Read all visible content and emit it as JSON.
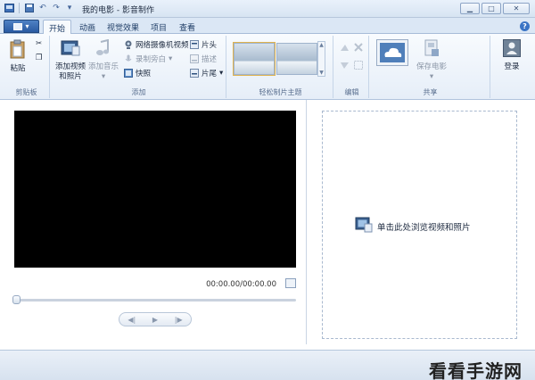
{
  "window": {
    "title": "我的电影 - 影音制作",
    "minimize_icon": "▁",
    "maximize_icon": "□",
    "close_icon": "✕"
  },
  "quick_access": {
    "save_icon": "💾",
    "undo_icon": "↶",
    "redo_icon": "↷",
    "more_icon": "▾"
  },
  "app_menu": {
    "arrow": "▾"
  },
  "tabs": [
    "开始",
    "动画",
    "视觉效果",
    "项目",
    "查看"
  ],
  "help": "?",
  "ribbon": {
    "clipboard": {
      "group_label": "剪贴板",
      "paste": "粘贴",
      "cut_icon": "✂",
      "copy_icon": "❐"
    },
    "add": {
      "group_label": "添加",
      "add_videos_line1": "添加视频",
      "add_videos_line2": "和照片",
      "add_music": "添加音乐",
      "add_music_arrow": "▾",
      "webcam": "网络摄像机视频",
      "narration": "录制旁白",
      "narration_arrow": "▾",
      "snapshot": "快照",
      "title": "片头",
      "caption": "描述",
      "credits": "片尾",
      "credits_arrow": "▾"
    },
    "themes": {
      "group_label": "轻松制片主题"
    },
    "editing": {
      "group_label": "编辑"
    },
    "share": {
      "group_label": "共享",
      "save_movie": "保存电影",
      "save_arrow": "▾",
      "sign_in": "登录"
    }
  },
  "player": {
    "timecode": "00:00.00/00:00.00",
    "prev_frame": "◀|",
    "play": "▶",
    "next_frame": "|▶"
  },
  "storyboard": {
    "browse_text": "单击此处浏览视频和照片"
  },
  "watermark": "看看手游网",
  "colors": {
    "accent": "#2a5aa2",
    "ribbon_bg": "#e6eef8",
    "video_bg": "#000000"
  }
}
